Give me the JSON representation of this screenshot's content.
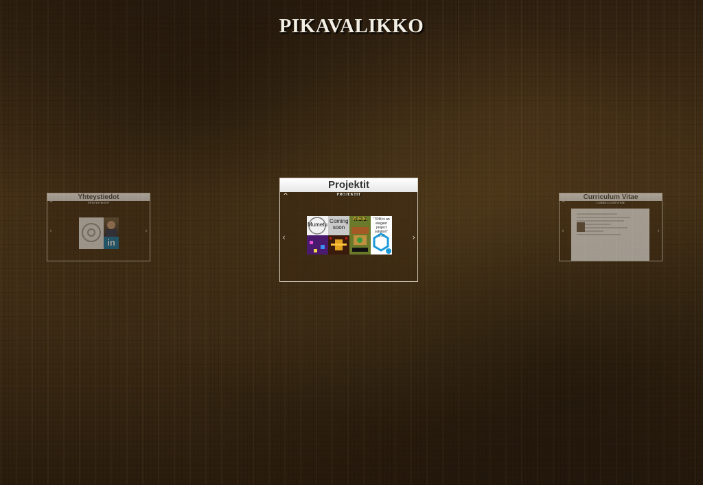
{
  "page": {
    "title": "PIKAVALIKKO"
  },
  "cards": {
    "left": {
      "header": "Yhteystiedot",
      "subtitle": "YHTEYSTIEDOT",
      "linkedin_label": "in"
    },
    "center": {
      "header": "Projektit",
      "subtitle": "PROJEKTIT",
      "thumbs": {
        "mumetu": "Mumetu",
        "coming_soon": "Coming soon",
        "ass": "A.S.S.",
        "quote": "\"TPM is an elegant project solution\" 9/10"
      }
    },
    "right": {
      "header": "Curriculum Vitae",
      "subtitle": "CURRICULUM VITAE"
    }
  },
  "arrows": {
    "up": "⌃",
    "left": "‹",
    "right": "›"
  },
  "colors": {
    "header_bg": "#ececec",
    "title_text": "#f2eee4",
    "linkedin": "#0e76a8"
  }
}
